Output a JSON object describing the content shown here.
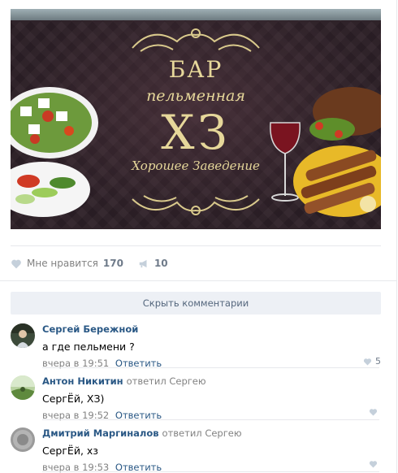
{
  "post": {
    "banner": {
      "heading": "БАР",
      "subheading": "пельменная",
      "big_letters": "ХЗ",
      "motto": "Хорошее Заведение"
    },
    "likes_label": "Мне нравится",
    "likes_count": "170",
    "shares_count": "10",
    "hide_comments_label": "Скрыть комментарии"
  },
  "comments": [
    {
      "author": "Сергей Бережной",
      "replied_to": "",
      "text": "а где пельмени ?",
      "time": "вчера в 19:51",
      "reply_label": "Ответить",
      "likes": "5"
    },
    {
      "author": "Антон Никитин",
      "replied_to": "ответил Сергею",
      "text": "СергЁй, ХЗ)",
      "time": "вчера в 19:52",
      "reply_label": "Ответить",
      "likes": ""
    },
    {
      "author": "Дмитрий Маргиналов",
      "replied_to": "ответил Сергею",
      "text": "СергЁй, хз",
      "time": "вчера в 19:53",
      "reply_label": "Ответить",
      "likes": ""
    }
  ],
  "colors": {
    "link": "#2a5885",
    "muted": "#828282",
    "button_bg": "#edf0f5",
    "banner_gold": "#e6d79a",
    "heart_icon": "#c5d0db"
  }
}
